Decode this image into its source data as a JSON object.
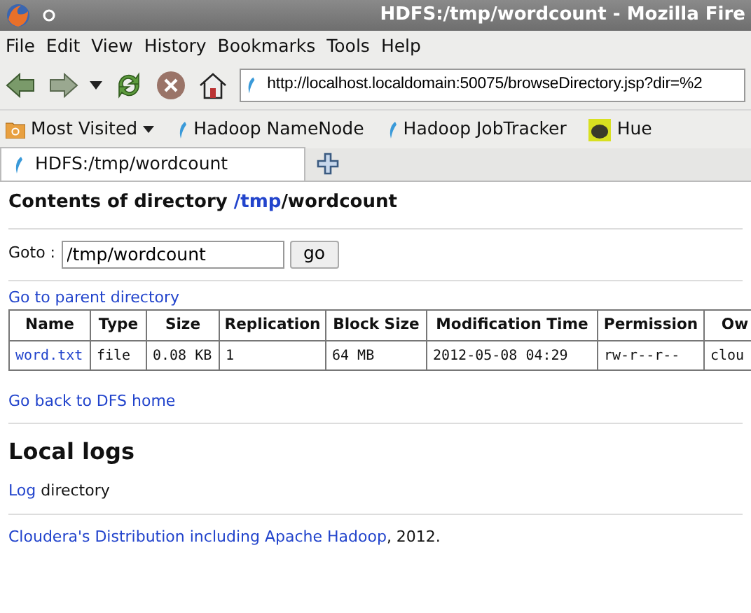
{
  "window": {
    "title": "HDFS:/tmp/wordcount - Mozilla Fire"
  },
  "menu": [
    "File",
    "Edit",
    "View",
    "History",
    "Bookmarks",
    "Tools",
    "Help"
  ],
  "address": {
    "value": "http://localhost.localdomain:50075/browseDirectory.jsp?dir=%2"
  },
  "bookmarks": [
    {
      "label": "Most Visited",
      "kind": "folder"
    },
    {
      "label": "Hadoop NameNode",
      "kind": "hadoop"
    },
    {
      "label": "Hadoop JobTracker",
      "kind": "hadoop"
    },
    {
      "label": "Hue",
      "kind": "hue"
    }
  ],
  "tabs": [
    {
      "label": "HDFS:/tmp/wordcount",
      "selected": true
    }
  ],
  "page": {
    "heading": {
      "prefix": "Contents of directory ",
      "link": "/tmp",
      "suffix": "/wordcount"
    },
    "goto": {
      "label": "Goto :",
      "value": "/tmp/wordcount",
      "button": "go"
    },
    "parent_link": "Go to parent directory",
    "table": {
      "columns": [
        "Name",
        "Type",
        "Size",
        "Replication",
        "Block Size",
        "Modification Time",
        "Permission",
        "Ow"
      ],
      "rows": [
        [
          "word.txt",
          "file",
          "0.08 KB",
          "1",
          "64 MB",
          "2012-05-08 04:29",
          "rw-r--r--",
          "clou"
        ]
      ]
    },
    "home_link": "Go back to DFS home",
    "logs_heading": "Local logs",
    "logs_line": {
      "link": "Log",
      "text": " directory"
    },
    "footer": {
      "link": "Cloudera's Distribution including Apache Hadoop",
      "text": ", 2012."
    }
  }
}
